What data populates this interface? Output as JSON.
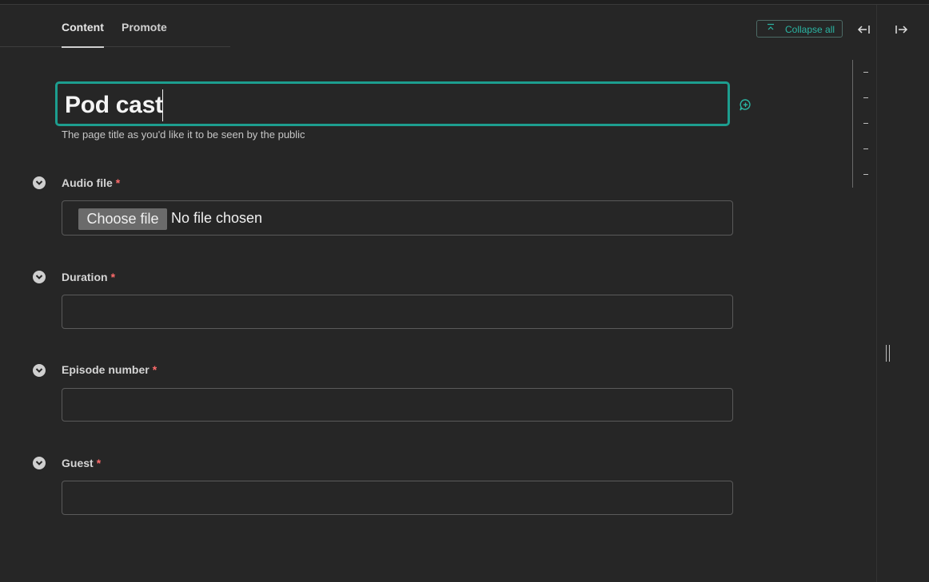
{
  "tabs": [
    {
      "label": "Content",
      "active": true
    },
    {
      "label": "Promote",
      "active": false
    }
  ],
  "toolbar": {
    "collapse_all": "Collapse all",
    "collapse_icon": "collapse-up-icon",
    "left_arrow_icon": "arrow-left-bar-icon",
    "right_arrow_icon": "arrow-right-bar-icon"
  },
  "title_field": {
    "value": "Pod cast",
    "help": "The page title as you'd like it to be seen by the public",
    "comment_icon": "add-comment-icon"
  },
  "fields": [
    {
      "label": "Audio file",
      "required": "*",
      "type": "file",
      "button": "Choose file",
      "status": "No file chosen"
    },
    {
      "label": "Duration",
      "required": "*",
      "type": "text",
      "value": ""
    },
    {
      "label": "Episode number",
      "required": "*",
      "type": "text",
      "value": ""
    },
    {
      "label": "Guest",
      "required": "*",
      "type": "text",
      "value": ""
    }
  ],
  "colors": {
    "accent": "#1d9e8f",
    "accent_text": "#2bb5a3",
    "required": "#ff6b6b",
    "background": "#262626"
  }
}
